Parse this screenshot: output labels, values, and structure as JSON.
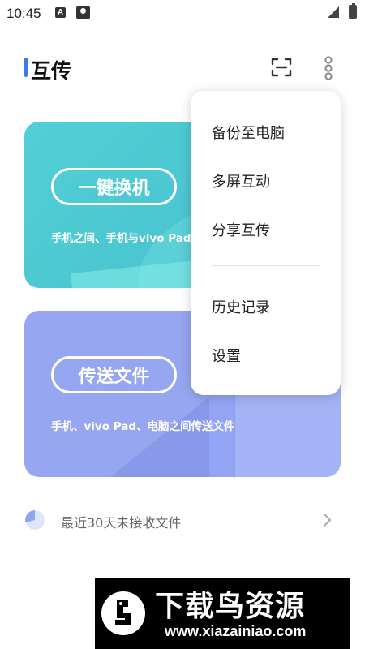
{
  "status_bar": {
    "time": "10:45",
    "notification_icons": [
      "a-letter-icon",
      "map-pin-icon"
    ],
    "system_icons": [
      "signal-icon",
      "battery-icon"
    ]
  },
  "header": {
    "title": "互传",
    "accent_color": "#3a7bf0",
    "actions": [
      "scan-icon",
      "more-vertical-icon"
    ]
  },
  "cards": {
    "switch": {
      "button_label": "一键换机",
      "description": "手机之间、手机与vivo Pad",
      "color": "#4ec8d3"
    },
    "transfer": {
      "button_label": "传送文件",
      "description": "手机、vivo Pad、电脑之间传送文件",
      "color": "#97a6f0"
    }
  },
  "recent": {
    "text": "最近30天未接收文件",
    "icon": "pie-chart-icon"
  },
  "menu": {
    "items": [
      {
        "label": "备份至电脑"
      },
      {
        "label": "多屏互动"
      },
      {
        "label": "分享互传"
      },
      {
        "label": "历史记录"
      },
      {
        "label": "设置"
      }
    ]
  },
  "watermark": {
    "title": "下载鸟资源",
    "url": "www.xiazainiao.com"
  }
}
